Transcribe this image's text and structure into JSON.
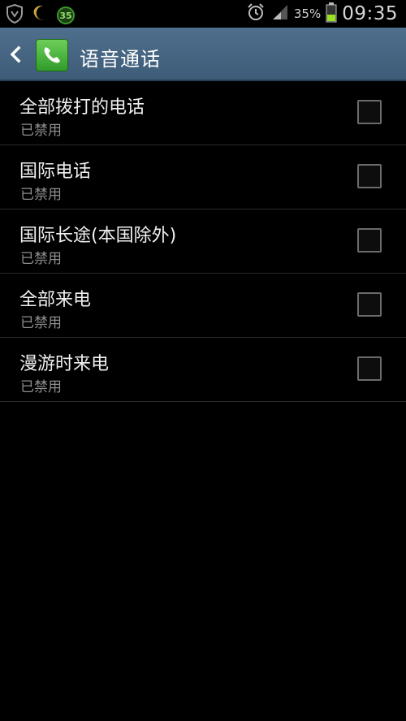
{
  "status_bar": {
    "notification_badge": "35",
    "battery_percent": "35%",
    "time": "09:35",
    "icons": [
      "shield-icon",
      "moon-icon",
      "alarm-icon",
      "signal-icon",
      "battery-icon"
    ],
    "colors": {
      "battery_fill": "#9be21e",
      "badge_green": "#3a9a2a"
    }
  },
  "action_bar": {
    "title": "语音通话",
    "back_icon": "chevron-left-icon",
    "app_icon": "phone-icon",
    "colors": {
      "background": "#4a6886",
      "app_icon_green": "#4cb53a"
    }
  },
  "list": {
    "items": [
      {
        "title": "全部拨打的电话",
        "summary": "已禁用",
        "checked": false
      },
      {
        "title": "国际电话",
        "summary": "已禁用",
        "checked": false
      },
      {
        "title": "国际长途(本国除外)",
        "summary": "已禁用",
        "checked": false
      },
      {
        "title": "全部来电",
        "summary": "已禁用",
        "checked": false
      },
      {
        "title": "漫游时来电",
        "summary": "已禁用",
        "checked": false
      }
    ]
  }
}
